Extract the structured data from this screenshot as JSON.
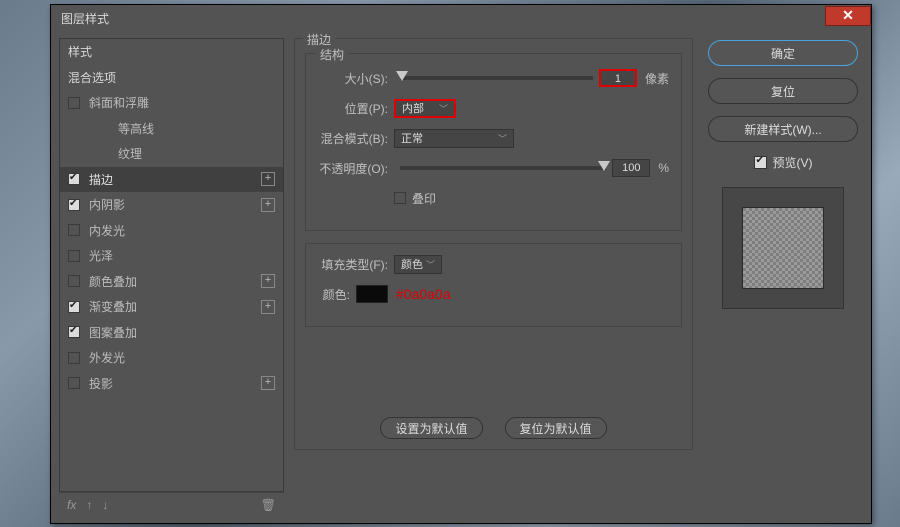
{
  "titlebar": {
    "title": "图层样式"
  },
  "sidebar": {
    "head_style": "样式",
    "head_blend": "混合选项",
    "items": [
      {
        "label": "斜面和浮雕",
        "checked": false,
        "plus": false,
        "selected": false
      },
      {
        "label": "等高线",
        "checked": false,
        "plus": false,
        "selected": false,
        "sub": true
      },
      {
        "label": "纹理",
        "checked": false,
        "plus": false,
        "selected": false,
        "sub": true
      },
      {
        "label": "描边",
        "checked": true,
        "plus": true,
        "selected": true
      },
      {
        "label": "内阴影",
        "checked": true,
        "plus": true,
        "selected": false
      },
      {
        "label": "内发光",
        "checked": false,
        "plus": false,
        "selected": false
      },
      {
        "label": "光泽",
        "checked": false,
        "plus": false,
        "selected": false
      },
      {
        "label": "颜色叠加",
        "checked": false,
        "plus": true,
        "selected": false
      },
      {
        "label": "渐变叠加",
        "checked": true,
        "plus": true,
        "selected": false
      },
      {
        "label": "图案叠加",
        "checked": true,
        "plus": false,
        "selected": false
      },
      {
        "label": "外发光",
        "checked": false,
        "plus": false,
        "selected": false
      },
      {
        "label": "投影",
        "checked": false,
        "plus": true,
        "selected": false
      }
    ],
    "footer_fx": "fx"
  },
  "main": {
    "group_stroke": "描边",
    "group_structure": "结构",
    "size_label": "大小(S):",
    "size_value": "1",
    "size_unit": "像素",
    "position_label": "位置(P):",
    "position_value": "内部",
    "blendmode_label": "混合模式(B):",
    "blendmode_value": "正常",
    "opacity_label": "不透明度(O):",
    "opacity_value": "100",
    "opacity_unit": "%",
    "overprint_label": "叠印",
    "filltype_label": "填充类型(F):",
    "filltype_value": "颜色",
    "color_label": "颜色:",
    "color_swatch": "#0a0a0a",
    "color_annotation": "#0a0a0a",
    "btn_default": "设置为默认值",
    "btn_reset": "复位为默认值"
  },
  "right": {
    "ok": "确定",
    "cancel": "复位",
    "new_style": "新建样式(W)...",
    "preview_label": "预览(V)"
  }
}
